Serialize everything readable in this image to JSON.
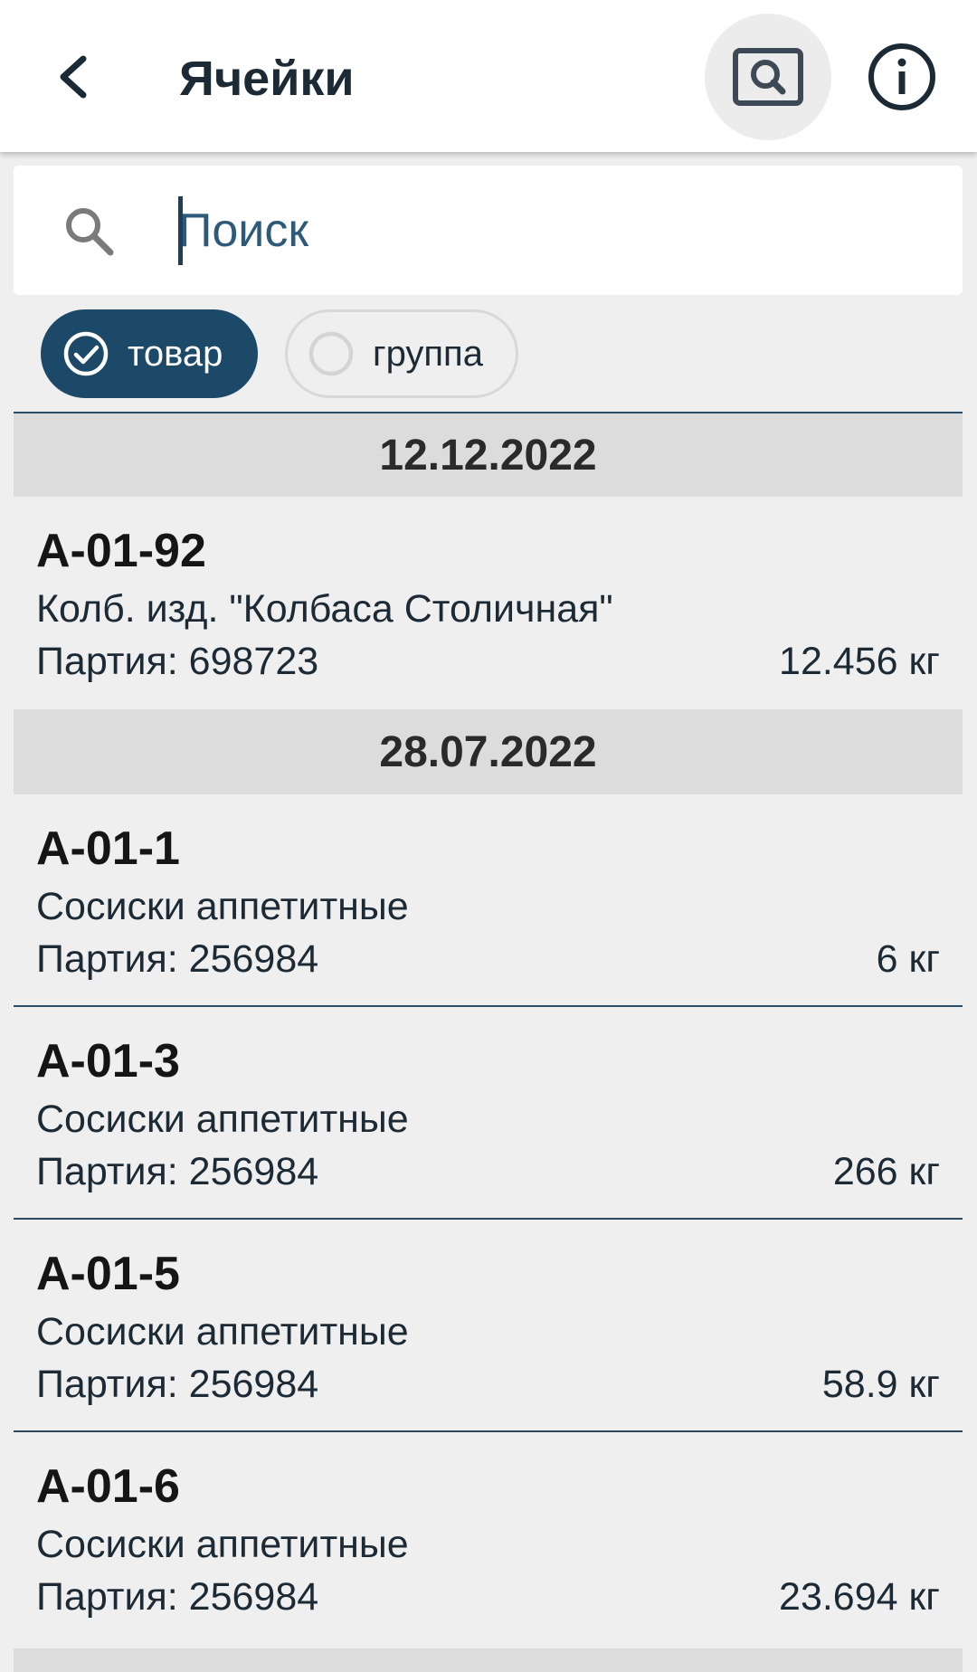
{
  "appbar": {
    "title": "Ячейки",
    "back_icon": "arrow-back-icon",
    "scan_icon": "scan-search-icon",
    "info_icon": "info-icon"
  },
  "search": {
    "placeholder": "Поиск",
    "value": ""
  },
  "filters": {
    "product": {
      "label": "товар",
      "selected": true
    },
    "group": {
      "label": "группа",
      "selected": false
    }
  },
  "groups": [
    {
      "date": "12.12.2022",
      "items": [
        {
          "cell": "A-01-92",
          "name": "Колб. изд. \"Колбаса Столичная\"",
          "batch": "Партия: 698723",
          "weight": "12.456 кг"
        }
      ]
    },
    {
      "date": "28.07.2022",
      "items": [
        {
          "cell": "A-01-1",
          "name": "Сосиски аппетитные",
          "batch": "Партия: 256984",
          "weight": "6 кг"
        },
        {
          "cell": "A-01-3",
          "name": "Сосиски аппетитные",
          "batch": "Партия: 256984",
          "weight": "266 кг"
        },
        {
          "cell": "A-01-5",
          "name": "Сосиски аппетитные",
          "batch": "Партия: 256984",
          "weight": "58.9 кг"
        },
        {
          "cell": "A-01-6",
          "name": "Сосиски аппетитные",
          "batch": "Партия: 256984",
          "weight": "23.694 кг"
        }
      ]
    }
  ],
  "colors": {
    "accent": "#1c4968",
    "text": "#1c2a36",
    "header_bg": "#dcdcdc",
    "background": "#efefef"
  }
}
